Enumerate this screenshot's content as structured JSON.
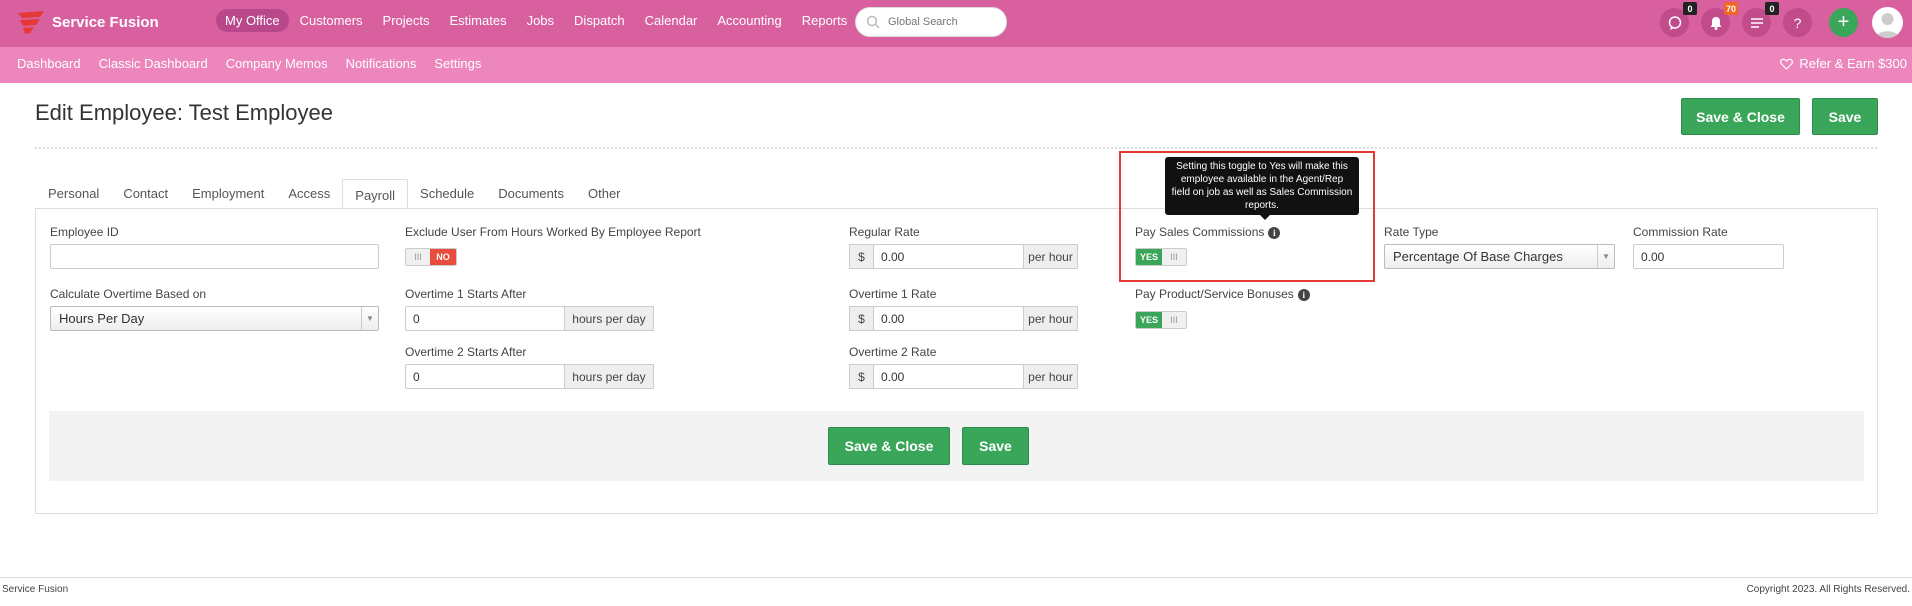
{
  "brand": {
    "name": "Service Fusion"
  },
  "main_nav": [
    "My Office",
    "Customers",
    "Projects",
    "Estimates",
    "Jobs",
    "Dispatch",
    "Calendar",
    "Accounting",
    "Reports"
  ],
  "search": {
    "placeholder": "Global Search"
  },
  "icons": {
    "chat_badge": "0",
    "bell_badge": "70",
    "list_badge": "0",
    "help": "?",
    "plus": "+"
  },
  "sub_nav": [
    "Dashboard",
    "Classic Dashboard",
    "Company Memos",
    "Notifications",
    "Settings"
  ],
  "refer": "Refer & Earn $300",
  "page": {
    "title": "Edit Employee: Test Employee",
    "save_close": "Save & Close",
    "save": "Save"
  },
  "tabs": [
    "Personal",
    "Contact",
    "Employment",
    "Access",
    "Payroll",
    "Schedule",
    "Documents",
    "Other"
  ],
  "form": {
    "employee_id_label": "Employee ID",
    "employee_id_value": "",
    "calc_overtime_label": "Calculate Overtime Based on",
    "calc_overtime_value": "Hours Per Day",
    "exclude_label": "Exclude User From Hours Worked By Employee Report",
    "exclude_value": "NO",
    "ot1_starts_label": "Overtime 1 Starts After",
    "ot1_starts_value": "0",
    "ot2_starts_label": "Overtime 2 Starts After",
    "ot2_starts_value": "0",
    "hours_per_day": "hours per day",
    "regular_rate_label": "Regular Rate",
    "regular_rate_value": "0.00",
    "ot1_rate_label": "Overtime 1 Rate",
    "ot1_rate_value": "0.00",
    "ot2_rate_label": "Overtime 2 Rate",
    "ot2_rate_value": "0.00",
    "currency": "$",
    "per_hour": "per hour",
    "pay_sales_label": "Pay Sales Commissions",
    "pay_sales_value": "YES",
    "pay_product_label": "Pay Product/Service Bonuses",
    "pay_product_value": "YES",
    "rate_type_label": "Rate Type",
    "rate_type_value": "Percentage Of Base Charges",
    "commission_rate_label": "Commission Rate",
    "commission_rate_value": "0.00",
    "toggle_grip": "III",
    "info": "i"
  },
  "tooltip": "Setting this toggle to Yes will make this employee available in the Agent/Rep field on job as well as Sales Commission reports.",
  "footer": {
    "left": "Service Fusion",
    "right": "Copyright 2023. All Rights Reserved."
  }
}
